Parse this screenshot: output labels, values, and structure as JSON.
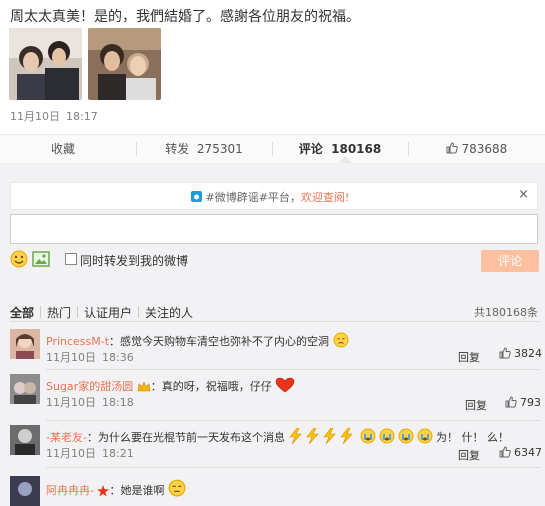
{
  "post": {
    "text": "周太太真美！是的，我們結婚了。感謝各位朋友的祝福。",
    "date": "11月10日",
    "time": "18:17"
  },
  "actions": {
    "favorite": "收藏",
    "repost": "转发",
    "repost_count": "275301",
    "comment": "评论",
    "comment_count": "180168",
    "like_count": "783688"
  },
  "notice": {
    "prefix": "#微博辟谣#平台，",
    "link": "欢迎查阅!",
    "close": "×"
  },
  "composer": {
    "also_repost": "同时转发到我的微博",
    "submit": "评论"
  },
  "filters": {
    "items": [
      "全部",
      "热门",
      "认证用户",
      "关注的人"
    ],
    "total": "共180168条"
  },
  "comments": [
    {
      "user": "PrincessM-t",
      "sep": "：",
      "text": "感觉今天购物车清空也弥补不了内心的空洞",
      "date": "11月10日",
      "time": "18:36",
      "reply": "回复",
      "likes": "3824"
    },
    {
      "user": "Sugar家的甜汤圆",
      "sep": "：",
      "text": "真的呀，祝福哦，仔仔",
      "date": "11月10日",
      "time": "18:18",
      "reply": "回复",
      "likes": "793"
    },
    {
      "user": "-某老友-",
      "sep": "：",
      "text": "为什么要在光棍节前一天发布这个消息",
      "text_tail": "为！ 什！ 么！",
      "date": "11月10日",
      "time": "18:21",
      "reply": "回复",
      "likes": "6347"
    },
    {
      "user": "阿冉冉冉-",
      "sep": "：",
      "text": "她是谁啊"
    }
  ],
  "colors": {
    "accent": "#eb7350",
    "submit_bg": "#ffc09f",
    "panel_bg": "#f2f2f5"
  }
}
